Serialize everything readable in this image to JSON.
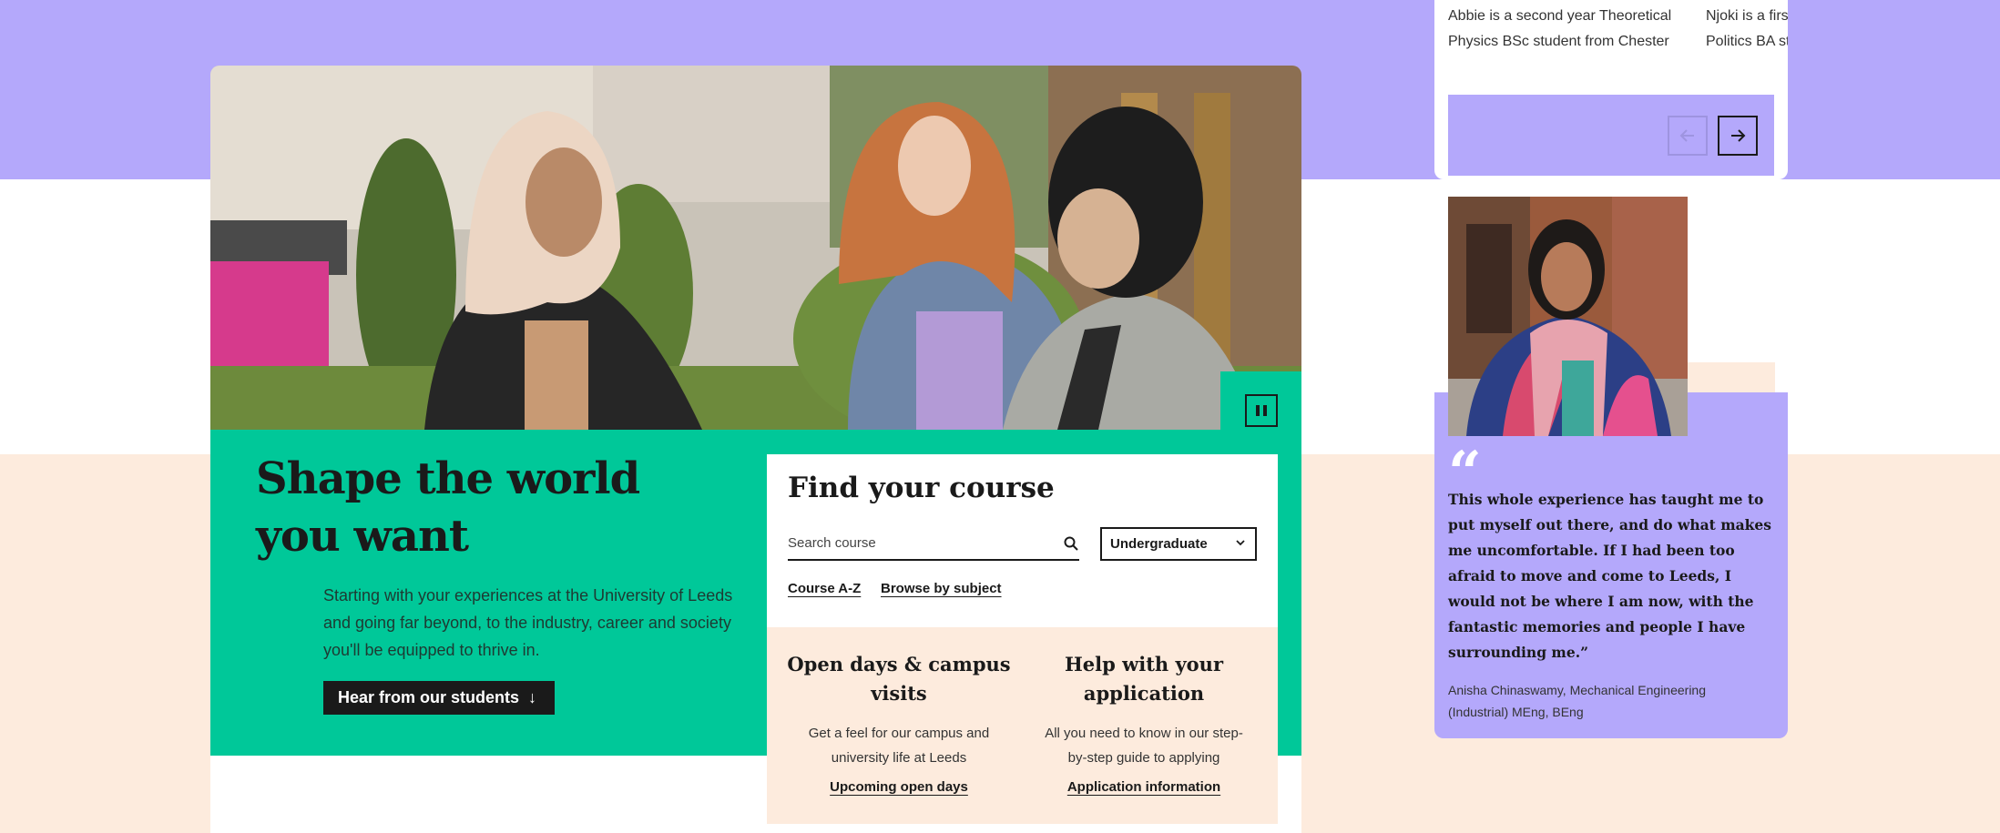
{
  "hero": {
    "title": "Shape the world you want",
    "description": "Starting with your experiences at the University of Leeds and going far beyond, to the industry, career and society you'll be equipped to thrive in.",
    "cta_label": "Hear from our students",
    "pause_icon": "pause-icon"
  },
  "find_course": {
    "title": "Find your course",
    "search_placeholder": "Search course",
    "level_selected": "Undergraduate",
    "links": {
      "az": "Course A-Z",
      "subject": "Browse by subject"
    }
  },
  "info": [
    {
      "title": "Open days & campus visits",
      "description": "Get a feel for our campus and university life at Leeds",
      "link": "Upcoming open days"
    },
    {
      "title": "Help with your application",
      "description": "All you need to know in our step-by-step guide to applying",
      "link": "Application information"
    }
  ],
  "stories": {
    "snippet_1_line_1": "Abbie is a second year Theoretical",
    "snippet_1_line_2": "Physics BSc student from Chester",
    "snippet_2_line_1": "Njoki is a firs",
    "snippet_2_line_2": "Politics BA st"
  },
  "quote": {
    "mark": "“",
    "text": "This whole experience has taught me to put myself out there, and do what makes me uncomfortable. If I had been too afraid to move and come to Leeds, I would not be where I am now, with the fantastic memories and people I have surrounding me.”",
    "attribution": "Anisha Chinaswamy, Mechanical Engineering (Industrial) MEng, BEng"
  },
  "colors": {
    "purple": "#b4a8fb",
    "green": "#00c899",
    "peach": "#fdebdd",
    "dark": "#1a1a1a"
  }
}
